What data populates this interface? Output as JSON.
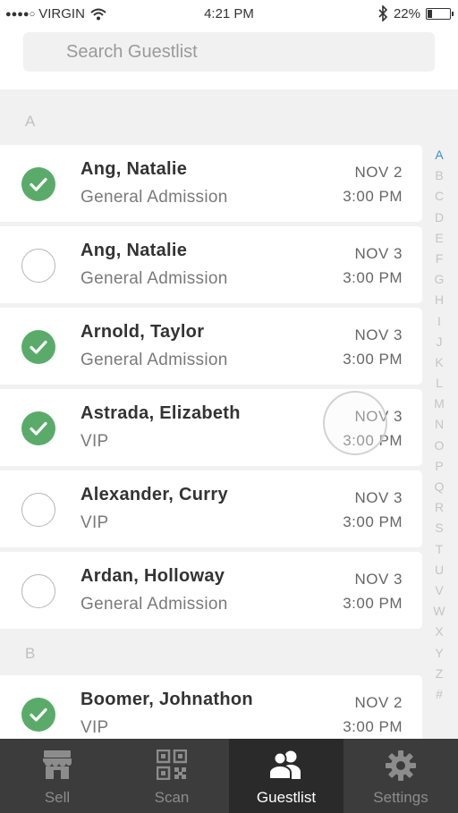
{
  "status": {
    "signal_dots": "●●●●○",
    "carrier": "VIRGIN",
    "time": "4:21 PM",
    "battery": "22%",
    "battery_level": 0.22
  },
  "search": {
    "placeholder": "Search Guestlist",
    "value": ""
  },
  "sections": [
    {
      "letter": "A",
      "guests": [
        {
          "name": "Ang, Natalie",
          "type": "General Admission",
          "date": "NOV 2",
          "time": "3:00 PM",
          "checked_in": true
        },
        {
          "name": "Ang, Natalie",
          "type": "General Admission",
          "date": "NOV 3",
          "time": "3:00 PM",
          "checked_in": false
        },
        {
          "name": "Arnold, Taylor",
          "type": "General Admission",
          "date": "NOV 3",
          "time": "3:00 PM",
          "checked_in": true
        },
        {
          "name": "Astrada, Elizabeth",
          "type": "VIP",
          "date": "NOV 3",
          "time": "3:00 PM",
          "checked_in": true
        },
        {
          "name": "Alexander, Curry",
          "type": "VIP",
          "date": "NOV 3",
          "time": "3:00 PM",
          "checked_in": false
        },
        {
          "name": "Ardan, Holloway",
          "type": "General Admission",
          "date": "NOV 3",
          "time": "3:00 PM",
          "checked_in": false
        }
      ]
    },
    {
      "letter": "B",
      "guests": [
        {
          "name": "Boomer, Johnathon",
          "type": "VIP",
          "date": "NOV 2",
          "time": "3:00 PM",
          "checked_in": true
        }
      ]
    }
  ],
  "index_letters": [
    "A",
    "B",
    "C",
    "D",
    "E",
    "F",
    "G",
    "H",
    "I",
    "J",
    "K",
    "L",
    "M",
    "N",
    "O",
    "P",
    "Q",
    "R",
    "S",
    "T",
    "U",
    "V",
    "W",
    "X",
    "Y",
    "Z",
    "#"
  ],
  "index_active": "A",
  "colors": {
    "checked": "#5aab6a",
    "index_active": "#3b8fd1",
    "tabbar_bg": "#3c3c3c"
  },
  "tabs": [
    {
      "label": "Sell",
      "icon": "store-icon",
      "active": false
    },
    {
      "label": "Scan",
      "icon": "qr-code-icon",
      "active": false
    },
    {
      "label": "Guestlist",
      "icon": "people-icon",
      "active": true
    },
    {
      "label": "Settings",
      "icon": "gear-icon",
      "active": false
    }
  ]
}
